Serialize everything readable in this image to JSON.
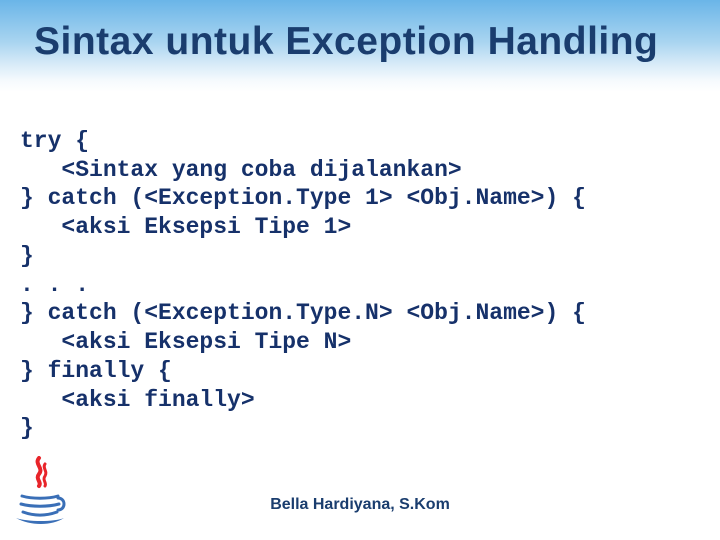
{
  "title": "Sintax untuk Exception Handling",
  "code_lines": [
    "try {",
    "   <Sintax yang coba dijalankan>",
    "} catch (<Exception.Type 1> <Obj.Name>) {",
    "   <aksi Eksepsi Tipe 1>",
    "}",
    ". . .",
    "} catch (<Exception.Type.N> <Obj.Name>) {",
    "   <aksi Eksepsi Tipe N>",
    "} finally {",
    "   <aksi finally>",
    "}"
  ],
  "footer": "Bella Hardiyana, S.Kom"
}
